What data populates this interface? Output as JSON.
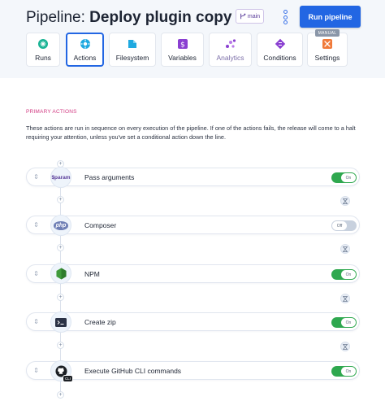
{
  "header": {
    "title_prefix": "Pipeline:",
    "title_name": "Deploy plugin copy",
    "branch": "main",
    "run_button": "Run pipeline"
  },
  "tabs": [
    {
      "label": "Runs",
      "icon": "runs-icon",
      "color": "#19b394",
      "active": false
    },
    {
      "label": "Actions",
      "icon": "actions-icon",
      "color": "#1ea9e0",
      "active": true
    },
    {
      "label": "Filesystem",
      "icon": "filesystem-icon",
      "color": "#1ea9e0",
      "active": false
    },
    {
      "label": "Variables",
      "icon": "variables-icon",
      "color": "#8a3fd1",
      "active": false
    },
    {
      "label": "Analytics",
      "icon": "analytics-icon",
      "color": "#8a3fd1",
      "active": false
    },
    {
      "label": "Conditions",
      "icon": "conditions-icon",
      "color": "#8a3fd1",
      "active": false
    },
    {
      "label": "Settings",
      "icon": "settings-icon",
      "color": "#f07a3a",
      "active": false,
      "badge": "MANUAL"
    }
  ],
  "section": {
    "label": "PRIMARY ACTIONS",
    "description": "These actions are run in sequence on every execution of the pipeline. If one of the actions fails, the release will come to a halt requiring your attention, unless you've set a conditional action down the line."
  },
  "actions": [
    {
      "name": "Pass arguments",
      "icon": "sparam-icon",
      "icon_text": "$param",
      "toggle": "On",
      "enabled": true
    },
    {
      "name": "Composer",
      "icon": "php-icon",
      "icon_text": "php",
      "toggle": "Off",
      "enabled": false
    },
    {
      "name": "NPM",
      "icon": "nodejs-icon",
      "toggle": "On",
      "enabled": true
    },
    {
      "name": "Create zip",
      "icon": "terminal-icon",
      "toggle": "On",
      "enabled": true
    },
    {
      "name": "Execute GitHub CLI commands",
      "icon": "github-cli-icon",
      "icon_text": "CLI",
      "toggle": "On",
      "enabled": true
    }
  ]
}
